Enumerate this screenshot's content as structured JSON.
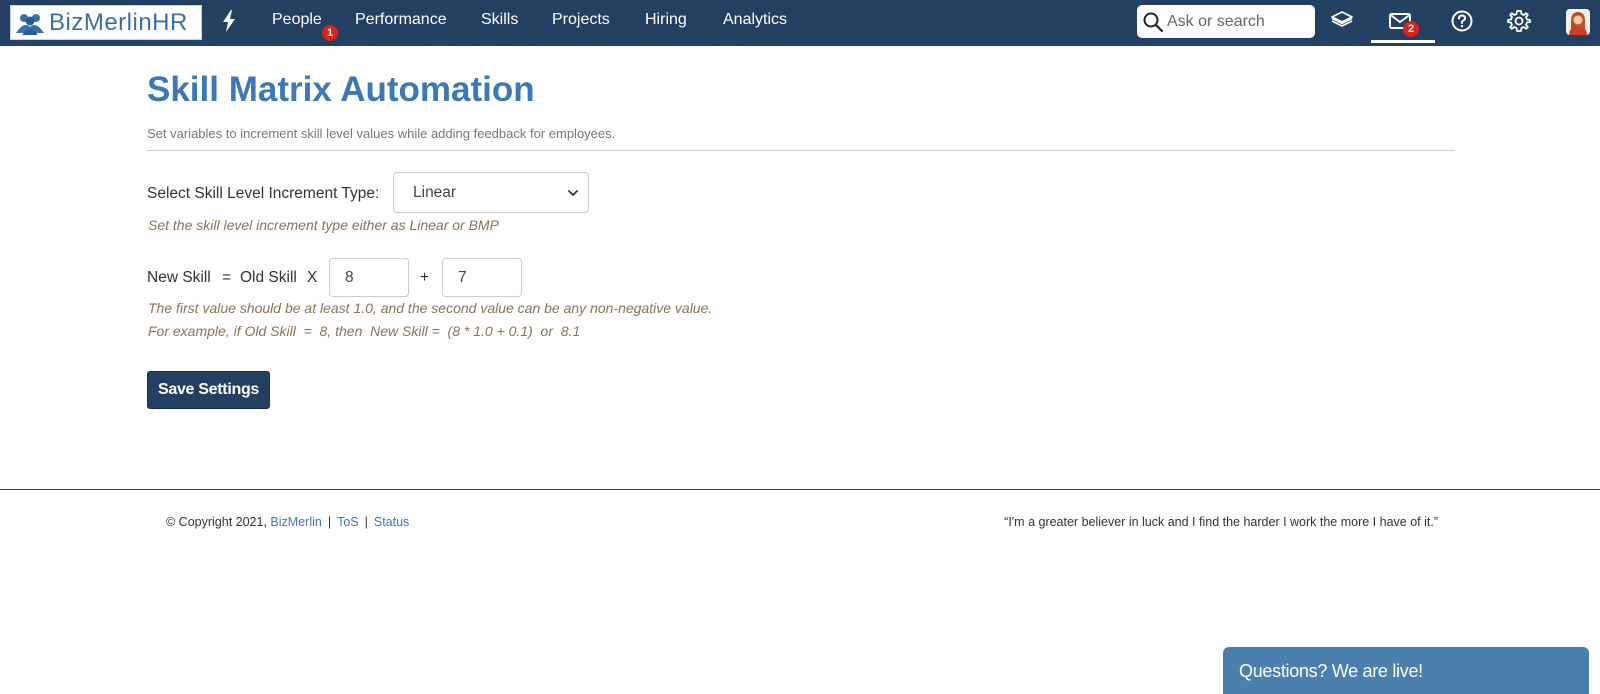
{
  "header": {
    "logo_text": "BizMerlinHR",
    "nav": [
      {
        "label": "People",
        "badge": "1"
      },
      {
        "label": "Performance"
      },
      {
        "label": "Skills"
      },
      {
        "label": "Projects"
      },
      {
        "label": "Hiring"
      },
      {
        "label": "Analytics"
      }
    ],
    "search_placeholder": "Ask or search",
    "mail_badge": "2",
    "icons": [
      "bolt-icon",
      "search-icon",
      "layers-icon",
      "mail-icon",
      "help-icon",
      "gear-icon",
      "avatar"
    ]
  },
  "main": {
    "title": "Skill Matrix Automation",
    "subtitle": "Set variables to increment skill level values while adding feedback for employees.",
    "increment_label": "Select Skill Level Increment Type:",
    "increment_selected": "Linear",
    "increment_help": "Set the skill level increment type either as Linear or BMP",
    "formula": {
      "new_skill": "New Skill",
      "equals": "=",
      "old_skill": "Old Skill",
      "times": "X",
      "plus": "+",
      "value1": "8",
      "value2": "7"
    },
    "help_line1": "The first value should be at least 1.0, and the second value can be any non-negative value.",
    "help_line2": "For example, if Old Skill  =  8, then  New Skill =  (8 * 1.0 + 0.1)  or  8.1",
    "save_label": "Save Settings"
  },
  "footer": {
    "copyright": "© Copyright 2021,",
    "company_link": "BizMerlin",
    "sep": "|",
    "tos_link": "ToS",
    "status_link": "Status",
    "quote": "“I'm a greater believer in luck and I find the harder I work the more I have of it.”"
  },
  "chat": {
    "label": "Questions? We are live!"
  },
  "colors": {
    "navbar": "#234063",
    "title": "#3b78b7",
    "badge": "#d9241c",
    "help_text": "#8b7355",
    "chat": "#4a7fae"
  }
}
